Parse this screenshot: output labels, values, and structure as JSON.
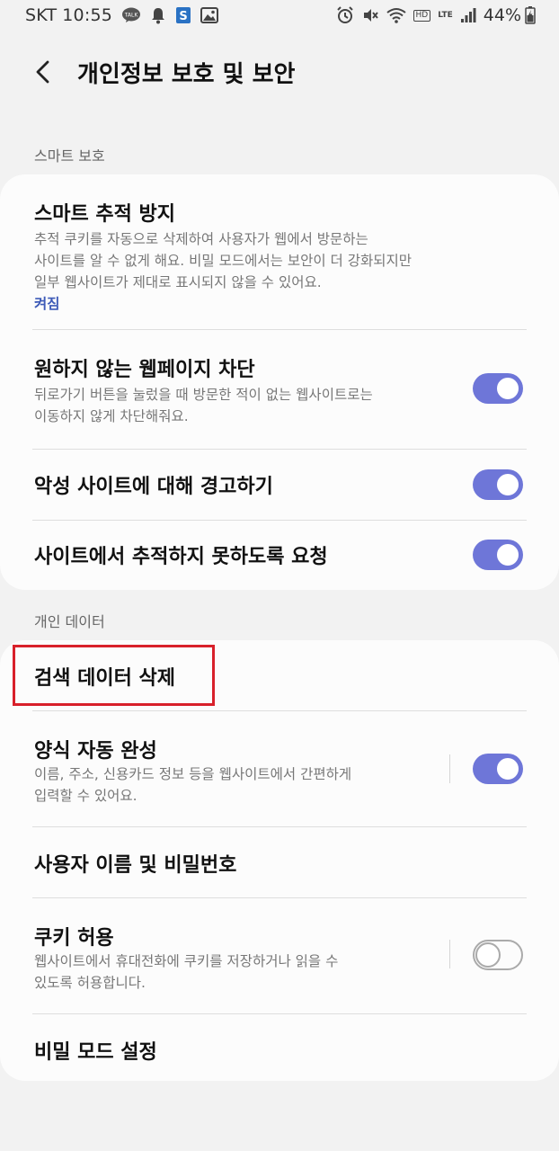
{
  "status_bar": {
    "carrier": "SKT",
    "time": "10:55",
    "left_icons": [
      "talk-icon",
      "bell-icon",
      "s-app-icon",
      "gallery-icon"
    ],
    "right_icons": [
      "alarm-icon",
      "mute-icon",
      "wifi-icon",
      "hd-voice-icon",
      "lte-icon",
      "signal-icon"
    ],
    "hd_label": "HD",
    "lte_label": "LTE",
    "battery": "44%"
  },
  "header": {
    "title": "개인정보 보호 및 보안"
  },
  "sections": {
    "smart": {
      "label": "스마트 보호",
      "items": [
        {
          "title": "스마트 추적 방지",
          "desc_lines": [
            "추적 쿠키를 자동으로 삭제하여 사용자가 웹에서 방문하는",
            "사이트를 알 수 없게 해요. 비밀 모드에서는 보안이 더 강화되지만",
            "일부 웹사이트가 제대로 표시되지 않을 수 있어요."
          ],
          "status": "켜짐"
        },
        {
          "title": "원하지 않는 웹페이지 차단",
          "desc_lines": [
            "뒤로가기 버튼을 눌렀을 때 방문한 적이 없는 웹사이트로는",
            "이동하지 않게 차단해줘요."
          ],
          "toggle": "on"
        },
        {
          "title": "악성 사이트에 대해 경고하기",
          "toggle": "on"
        },
        {
          "title": "사이트에서 추적하지 못하도록 요청",
          "toggle": "on"
        }
      ]
    },
    "personal": {
      "label": "개인 데이터",
      "items": [
        {
          "title": "검색 데이터 삭제"
        },
        {
          "title": "양식 자동 완성",
          "desc_lines": [
            "이름, 주소, 신용카드 정보 등을 웹사이트에서 간편하게",
            "입력할 수 있어요."
          ],
          "toggle": "on"
        },
        {
          "title": "사용자 이름 및 비밀번호"
        },
        {
          "title": "쿠키 허용",
          "desc_lines": [
            "웹사이트에서 휴대전화에 쿠키를 저장하거나 읽을 수",
            "있도록 허용합니다."
          ],
          "toggle": "off"
        },
        {
          "title": "비밀 모드 설정"
        }
      ]
    }
  },
  "colors": {
    "accent": "#6e76d8",
    "status_link": "#3e5bb8",
    "highlight": "#d8202a",
    "background": "#f2f2f2",
    "card": "#fcfcfc"
  }
}
